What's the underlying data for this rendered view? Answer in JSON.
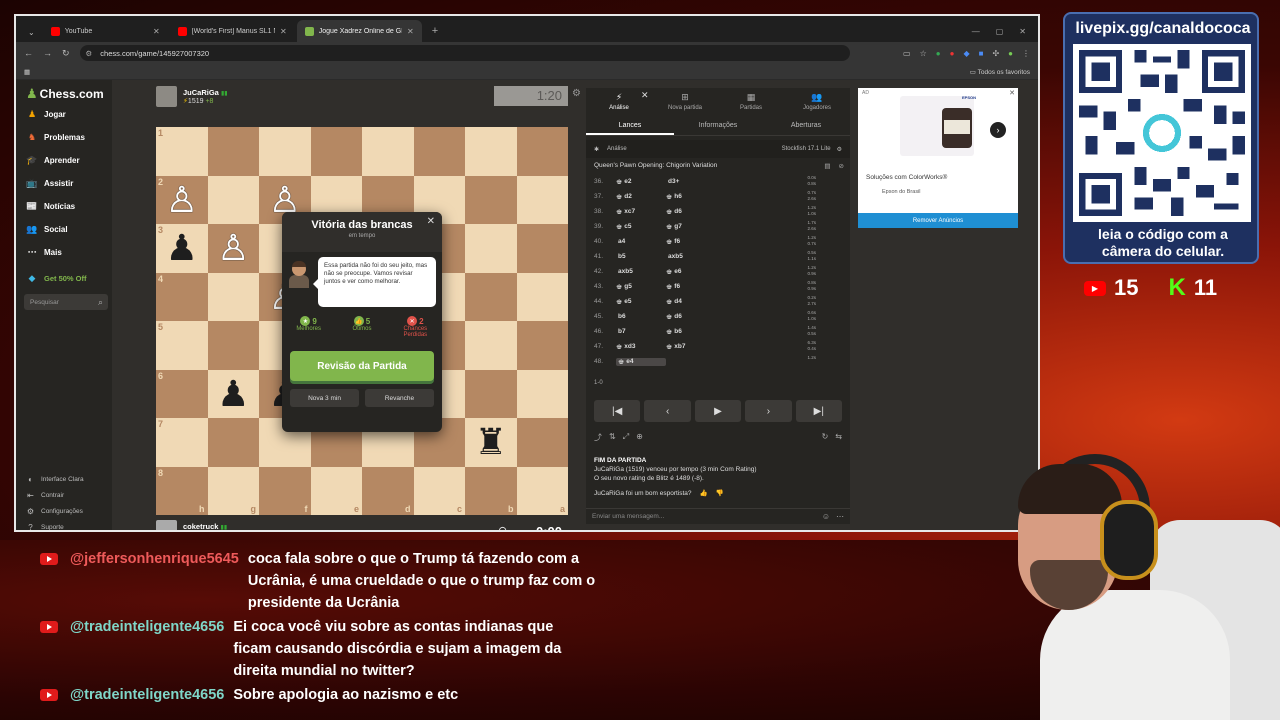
{
  "browser": {
    "tabs": [
      {
        "title": "YouTube",
        "color": "#ff0000",
        "active": false
      },
      {
        "title": "[World's First] Manus SL1 No S",
        "color": "#ff0000",
        "active": false
      },
      {
        "title": "Jogue Xadrez Online de GRAÇA",
        "color": "#81b64c",
        "active": true
      }
    ],
    "url": "chess.com/game/145927007320",
    "bookmarks_label": "Todos os favoritos"
  },
  "sidebar": {
    "logo": "Chess.com",
    "items": [
      {
        "label": "Jogar",
        "icon": "play-icon",
        "color": "#f2a200"
      },
      {
        "label": "Problemas",
        "icon": "puzzle-icon",
        "color": "#f26b36"
      },
      {
        "label": "Aprender",
        "icon": "learn-icon",
        "color": "#5ca9e6"
      },
      {
        "label": "Assistir",
        "icon": "watch-icon",
        "color": "#9bd0f5"
      },
      {
        "label": "Notícias",
        "icon": "news-icon",
        "color": "#cccccc"
      },
      {
        "label": "Social",
        "icon": "social-icon",
        "color": "#3fb9e6"
      },
      {
        "label": "Mais",
        "icon": "more-icon",
        "color": "#cccccc"
      }
    ],
    "promo": "Get 50% Off",
    "search_placeholder": "Pesquisar",
    "bottom": [
      {
        "label": "Interface Clara",
        "icon": "theme-icon"
      },
      {
        "label": "Contrair",
        "icon": "collapse-icon"
      },
      {
        "label": "Configurações",
        "icon": "settings-icon"
      },
      {
        "label": "Suporte",
        "icon": "support-icon"
      }
    ]
  },
  "top_player": {
    "name": "JuCaRiGa",
    "rating": "1519",
    "gain": "+8",
    "clock": "1:20"
  },
  "bottom_player": {
    "name": "coketruck",
    "rating": "1489",
    "loss": "-8",
    "score": "0",
    "clock": "0:00"
  },
  "board": {
    "ranks": [
      "1",
      "2",
      "3",
      "4",
      "5",
      "6",
      "7",
      "8"
    ],
    "files": [
      "h",
      "g",
      "f",
      "e",
      "d",
      "c",
      "b",
      "a"
    ],
    "pieces": [
      {
        "row": 1,
        "col": 0,
        "glyph": "♙",
        "side": "white"
      },
      {
        "row": 1,
        "col": 2,
        "glyph": "♙",
        "side": "white"
      },
      {
        "row": 2,
        "col": 0,
        "glyph": "♟",
        "side": "black"
      },
      {
        "row": 2,
        "col": 1,
        "glyph": "♙",
        "side": "white"
      },
      {
        "row": 3,
        "col": 2,
        "glyph": "♙",
        "side": "white"
      },
      {
        "row": 5,
        "col": 1,
        "glyph": "♟",
        "side": "black"
      },
      {
        "row": 5,
        "col": 2,
        "glyph": "♟",
        "side": "black"
      },
      {
        "row": 6,
        "col": 6,
        "glyph": "♜",
        "side": "black"
      }
    ]
  },
  "modal": {
    "title": "Vitória das brancas",
    "subtitle": "em tempo",
    "coach_message": "Essa partida não foi do seu jeito, mas não se preocupe. Vamos revisar juntos e ver como melhorar.",
    "stats": [
      {
        "value": "9",
        "label": "Melhores",
        "color": "#81b64c"
      },
      {
        "value": "5",
        "label": "Ótimos",
        "color": "#81b64c"
      },
      {
        "value": "2",
        "label": "Chances Perdidas",
        "color": "#e0524a"
      }
    ],
    "review_button": "Revisão da Partida",
    "new_game_button": "Nova 3 min",
    "rematch_button": "Revanche"
  },
  "panel": {
    "tabs": [
      {
        "label": "Análise",
        "icon": "analysis-icon"
      },
      {
        "label": "Nova partida",
        "icon": "new-game-icon"
      },
      {
        "label": "Partidas",
        "icon": "games-icon"
      },
      {
        "label": "Jogadores",
        "icon": "players-icon"
      }
    ],
    "subtabs": [
      "Lances",
      "Informações",
      "Aberturas"
    ],
    "analysis_label": "Análise",
    "engine": "Stockfish 17.1 Lite",
    "opening": "Queen's Pawn Opening: Chigorin Variation",
    "moves": [
      {
        "n": "36.",
        "w": "e2",
        "wp": "♚",
        "b": "d3+",
        "bp": "",
        "e1": "0.0s",
        "e2": "0.8s"
      },
      {
        "n": "37.",
        "w": "d2",
        "wp": "♚",
        "b": "h6",
        "bp": "♚",
        "e1": "0.7s",
        "e2": "2.6s"
      },
      {
        "n": "38.",
        "w": "xc7",
        "wp": "♚",
        "b": "d6",
        "bp": "♚",
        "e1": "1.2s",
        "e2": "1.0s"
      },
      {
        "n": "39.",
        "w": "c5",
        "wp": "♚",
        "b": "g7",
        "bp": "♚",
        "e1": "1.7s",
        "e2": "2.6s"
      },
      {
        "n": "40.",
        "w": "a4",
        "wp": "",
        "b": "f6",
        "bp": "♚",
        "e1": "1.2s",
        "e2": "0.7s"
      },
      {
        "n": "41.",
        "w": "b5",
        "wp": "",
        "b": "axb5",
        "bp": "",
        "e1": "0.5s",
        "e2": "1.1s"
      },
      {
        "n": "42.",
        "w": "axb5",
        "wp": "",
        "b": "e6",
        "bp": "♚",
        "e1": "1.2s",
        "e2": "0.9s"
      },
      {
        "n": "43.",
        "w": "g5",
        "wp": "♚",
        "b": "f6",
        "bp": "♚",
        "e1": "0.8s",
        "e2": "0.9s"
      },
      {
        "n": "44.",
        "w": "e5",
        "wp": "♚",
        "b": "d4",
        "bp": "♚",
        "e1": "0.2s",
        "e2": "2.7s"
      },
      {
        "n": "45.",
        "w": "b6",
        "wp": "",
        "b": "d6",
        "bp": "♚",
        "e1": "0.6s",
        "e2": "1.0s"
      },
      {
        "n": "46.",
        "w": "b7",
        "wp": "",
        "b": "b6",
        "bp": "♚",
        "e1": "1.4s",
        "e2": "0.5s"
      },
      {
        "n": "47.",
        "w": "xd3",
        "wp": "♚",
        "b": "xb7",
        "bp": "♚",
        "e1": "6.3s",
        "e2": "0.4s"
      },
      {
        "n": "48.",
        "w": "e4",
        "wp": "♚",
        "b": "",
        "bp": "",
        "e1": "1.2s",
        "e2": ""
      }
    ],
    "result_score": "1-0",
    "result_title": "FIM DA PARTIDA",
    "result_line1": "JuCaRiGa (1519) venceu por tempo (3 min Com Rating)",
    "result_line2": "O seu novo rating de Blitz é 1489 (-8).",
    "sportsman": "JuCaRiGa foi um bom esportista?",
    "chat_placeholder": "Enviar uma mensagem..."
  },
  "ad": {
    "label": "AD",
    "brand": "EPSON",
    "title": "Soluções com ColorWorks®",
    "subtitle": "Epson do Brasil",
    "remove": "Remover Anúncios"
  },
  "overlay": {
    "qr_top": "livepix.gg/canaldococa",
    "qr_bottom_1": "leia o código com a",
    "qr_bottom_2": "câmera do celular.",
    "youtube_count": "15",
    "kick_count": "11",
    "kick_letter": "K",
    "messages": [
      {
        "user": "@jeffersonhenrique5645",
        "text": "coca fala sobre o que o Trump tá fazendo com a Ucrânia, é uma crueldade o que o trump faz com o presidente da Ucrânia"
      },
      {
        "user": "@tradeinteligente4656",
        "text": "Ei coca você viu sobre as contas indianas que ficam causando discórdia e sujam a imagem da direita mundial no twitter?"
      },
      {
        "user": "@tradeinteligente4656",
        "text": "Sobre apologia ao nazismo e etc"
      }
    ]
  }
}
